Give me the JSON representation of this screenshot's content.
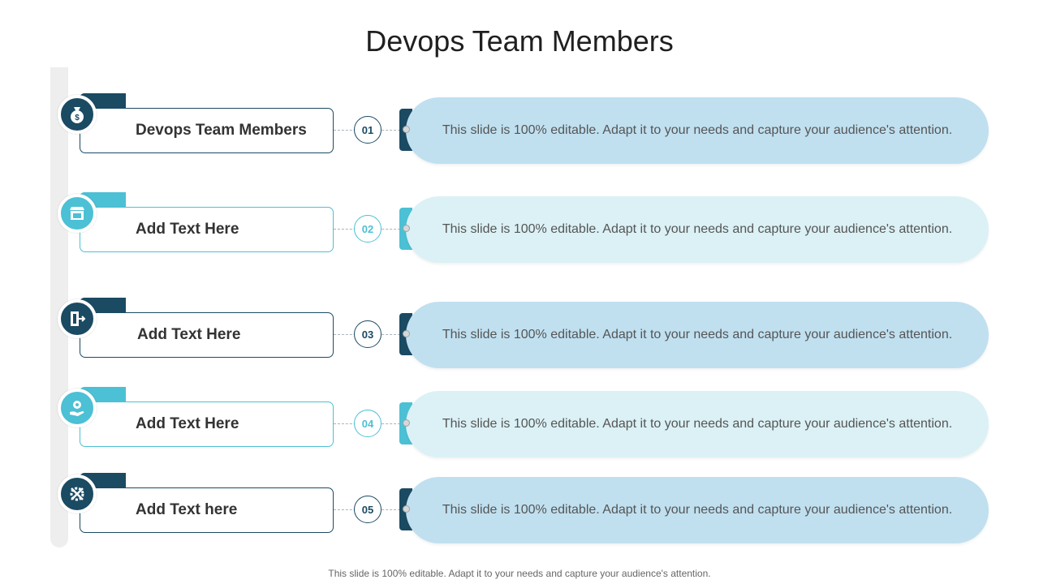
{
  "slide": {
    "title": "Devops Team Members",
    "footer": "This slide is 100% editable. Adapt it to your needs and capture your audience's attention."
  },
  "colors": {
    "dark": "#1b4a63",
    "light": "#4cc0d4",
    "pill_dark": "#c0e0f0",
    "pill_light": "#dbf1f5"
  },
  "items": [
    {
      "label": "Devops Team Members",
      "number": "01",
      "text": "This slide is 100% editable. Adapt it to your needs and capture your audience's attention.",
      "icon": "money-bag-icon"
    },
    {
      "label": "Add Text Here",
      "number": "02",
      "text": "This slide is 100% editable. Adapt it to your needs and capture your audience's attention.",
      "icon": "storefront-icon"
    },
    {
      "label": "Add Text Here",
      "number": "03",
      "text": "This slide is 100% editable. Adapt it to your needs and capture your audience's attention.",
      "icon": "exit-door-icon"
    },
    {
      "label": "Add Text Here",
      "number": "04",
      "text": "This slide is 100% editable. Adapt it to your needs and capture your audience's attention.",
      "icon": "hand-gear-icon"
    },
    {
      "label": "Add Text here",
      "number": "05",
      "text": "This slide is 100% editable. Adapt it to your needs and capture your audience's attention.",
      "icon": "tools-gear-icon"
    }
  ]
}
